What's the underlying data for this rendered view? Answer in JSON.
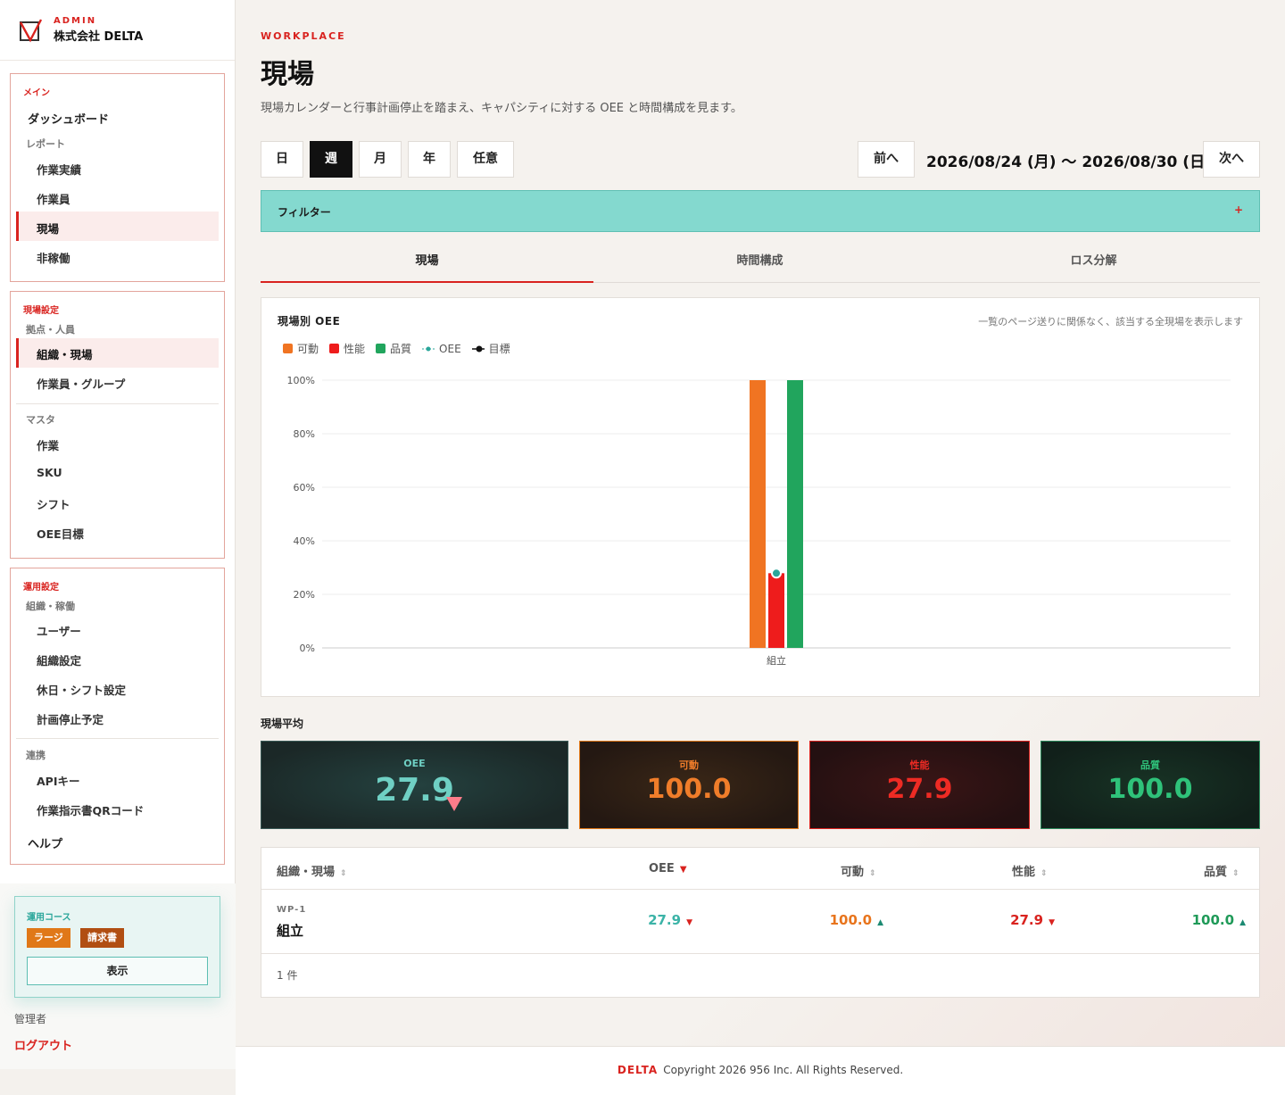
{
  "brand": {
    "admin": "ADMIN",
    "company": "株式会社 DELTA"
  },
  "sidebar": {
    "main": {
      "section": "メイン",
      "dashboard": "ダッシュボード",
      "report": "レポート",
      "items": [
        "作業実績",
        "作業員",
        "現場",
        "非稼働"
      ]
    },
    "site": {
      "section": "現場設定",
      "group1": "拠点・人員",
      "group1_items": [
        "組織・現場",
        "作業員・グループ"
      ],
      "group2": "マスタ",
      "group2_items": [
        "作業",
        "SKU",
        "シフト",
        "OEE目標"
      ]
    },
    "ops": {
      "section": "運用設定",
      "group1": "組織・稼働",
      "group1_items": [
        "ユーザー",
        "組織設定",
        "休日・シフト設定",
        "計画停止予定"
      ],
      "group2": "連携",
      "group2_items": [
        "APIキー",
        "作業指示書QRコード"
      ],
      "help": "ヘルプ"
    },
    "plan": {
      "title": "運用コース",
      "tag1": "ラージ",
      "tag2": "請求書",
      "show": "表示"
    },
    "user": "管理者",
    "logout": "ログアウト"
  },
  "header": {
    "eyebrow": "WORKPLACE",
    "title": "現場",
    "desc": "現場カレンダーと行事計画停止を踏まえ、キャパシティに対する OEE と時間構成を見ます。"
  },
  "period": {
    "day": "日",
    "week": "週",
    "month": "月",
    "year": "年",
    "custom": "任意",
    "prev": "前へ",
    "next": "次へ",
    "range": "2026/08/24 (月) 〜 2026/08/30 (日)"
  },
  "filter": {
    "label": "フィルター",
    "toggle": "+"
  },
  "tabs": [
    "現場",
    "時間構成",
    "ロス分解"
  ],
  "chart_card": {
    "title": "現場別 OEE",
    "note": "一覧のページ送りに関係なく、該当する全現場を表示します",
    "legend": {
      "availability": "可動",
      "performance": "性能",
      "quality": "品質",
      "oee": "OEE",
      "target": "目標"
    }
  },
  "chart_data": {
    "type": "bar",
    "categories": [
      "組立"
    ],
    "series": [
      {
        "name": "可動",
        "values": [
          100
        ],
        "color": "#f07422"
      },
      {
        "name": "性能",
        "values": [
          27.9
        ],
        "color": "#ee1c1c"
      },
      {
        "name": "品質",
        "values": [
          100
        ],
        "color": "#21a55d"
      }
    ],
    "oee": [
      27.9
    ],
    "oee_color": "#2aa69a",
    "yticks": [
      "100%",
      "80%",
      "60%",
      "40%",
      "20%",
      "0%"
    ],
    "ylim": [
      0,
      100
    ]
  },
  "average": {
    "title": "現場平均",
    "oee": {
      "label": "OEE",
      "value": "27.9"
    },
    "availability": {
      "label": "可動",
      "value": "100.0"
    },
    "performance": {
      "label": "性能",
      "value": "27.9"
    },
    "quality": {
      "label": "品質",
      "value": "100.0"
    }
  },
  "table": {
    "headers": {
      "site": "組織・現場",
      "oee": "OEE",
      "availability": "可動",
      "performance": "性能",
      "quality": "品質"
    },
    "row": {
      "code": "WP-1",
      "name": "組立",
      "oee": "27.9",
      "availability": "100.0",
      "performance": "27.9",
      "quality": "100.0"
    },
    "count": "1 件"
  },
  "footer": {
    "brand": "DELTA",
    "copyright": "Copyright 2026 956 Inc. All Rights Reserved."
  }
}
